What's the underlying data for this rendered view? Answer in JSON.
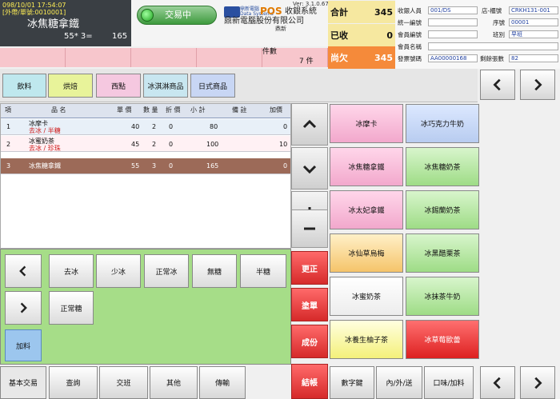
{
  "order": {
    "timestamp": "098/10/01 17:54:07",
    "type": "[外帶/單號:0010001]",
    "current_item": "冰焦糖拿鐵",
    "qty_text": "55* 3=",
    "line_total": "165"
  },
  "status": {
    "label": "交易中"
  },
  "brand": {
    "logo_text": "鼎新電腦",
    "logo_sub": "Data Systems",
    "pos": "POS",
    "system": "收銀系統",
    "version": "Ver: 3.1.0.67",
    "company": "鼎新電腦股份有限公司",
    "sub": "鼎新"
  },
  "totals": [
    {
      "label": "合計",
      "value": "345"
    },
    {
      "label": "已收",
      "value": "0"
    },
    {
      "label": "尚欠",
      "value": "345"
    }
  ],
  "info": {
    "cashier_label": "收銀人員",
    "cashier": "001/DS",
    "store_label": "店-櫃號",
    "store": "CRKH131-001",
    "tax_label": "統一編號",
    "tax": "",
    "serial_label": "序號",
    "serial": "00001",
    "member_id_label": "會員編號",
    "member_id": "",
    "shift_label": "班別",
    "shift": "早班",
    "member_name_label": "會員名稱",
    "member_name": "",
    "invoice_label": "發票號碼",
    "invoice": "AA00000168",
    "remaining_label": "剩餘張數",
    "remaining": "82"
  },
  "pieces": {
    "label": "件數",
    "value": "7 件"
  },
  "categories": [
    "飲料",
    "烘焙",
    "西點",
    "冰淇淋商品",
    "日式商品"
  ],
  "table": {
    "headers": [
      "項",
      "品 名",
      "單 價",
      "數 量",
      "折 價",
      "小 計",
      "備 註",
      "加價"
    ],
    "rows": [
      {
        "no": "1",
        "name": "冰摩卡",
        "mods": "去冰 / 半糖",
        "price": "40",
        "qty": "2",
        "disc": "0",
        "subtotal": "80",
        "note": "",
        "extra": "0"
      },
      {
        "no": "2",
        "name": "冰蜜奶茶",
        "mods": "去冰 / 珍珠",
        "price": "45",
        "qty": "2",
        "disc": "0",
        "subtotal": "100",
        "note": "",
        "extra": "10"
      },
      {
        "no": "3",
        "name": "冰焦糖拿鐵",
        "mods": "",
        "price": "55",
        "qty": "3",
        "disc": "0",
        "subtotal": "165",
        "note": "",
        "extra": "0"
      }
    ]
  },
  "actions": {
    "correct": "更正",
    "void": "塗單",
    "combo": "成份",
    "checkout": "結帳"
  },
  "modifiers": [
    "去冰",
    "少冰",
    "正常冰",
    "無糖",
    "半糖",
    "正常糖"
  ],
  "add_price": "加料",
  "products": [
    {
      "name": "冰摩卡",
      "color": "pink"
    },
    {
      "name": "冰巧克力牛奶",
      "color": "blue"
    },
    {
      "name": "冰焦糖拿鐵",
      "color": "pink"
    },
    {
      "name": "冰焦糖奶茶",
      "color": "green"
    },
    {
      "name": "冰太妃拿鐵",
      "color": "pink"
    },
    {
      "name": "冰錫蘭奶茶",
      "color": "green"
    },
    {
      "name": "冰仙草烏梅",
      "color": "orange"
    },
    {
      "name": "冰黑醋栗茶",
      "color": "green"
    },
    {
      "name": "冰蜜奶茶",
      "color": "white"
    },
    {
      "name": "冰抹茶牛奶",
      "color": "green"
    },
    {
      "name": "冰養生柚子茶",
      "color": "yellow"
    },
    {
      "name": "冰草莓歐蕾",
      "color": "red"
    }
  ],
  "bottom_tabs": [
    "基本交易",
    "查詢",
    "交班",
    "其他",
    "傳輸"
  ],
  "bottom_actions": [
    "數字鍵",
    "內/外/送",
    "口味/加料"
  ],
  "colors": {
    "accent_orange": "#f58a3a",
    "total_bg": "#f6e8a0",
    "modifier_panel": "#a6dd88",
    "selected_row": "#9c6a58"
  }
}
